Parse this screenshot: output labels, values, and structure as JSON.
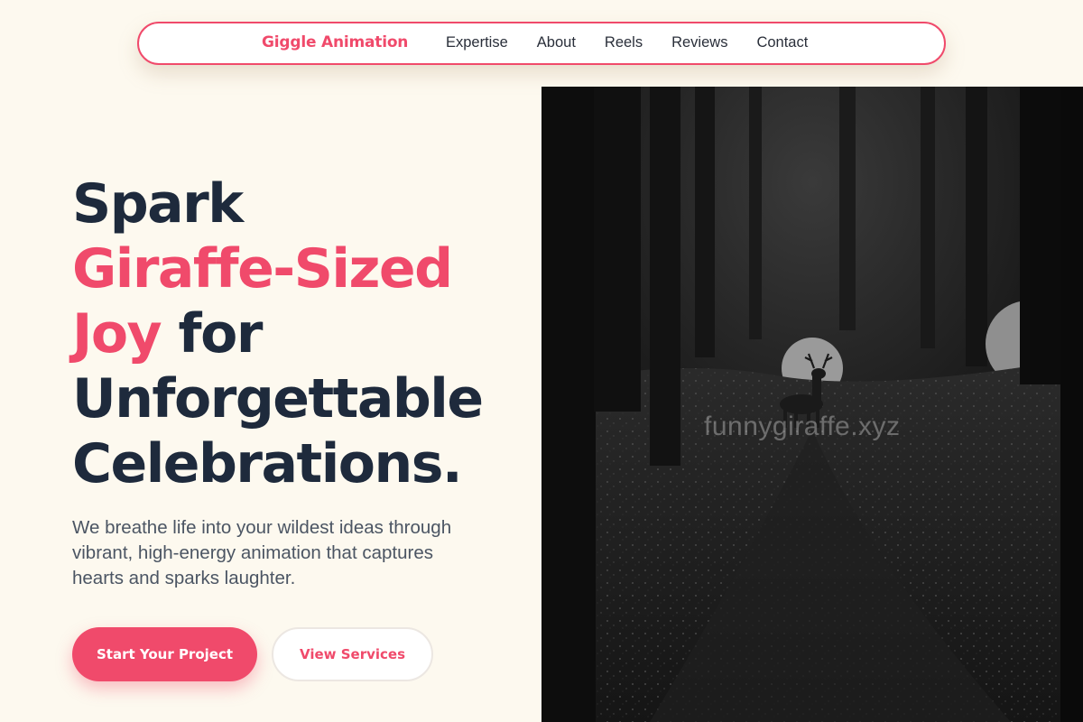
{
  "nav": {
    "brand": "Giggle Animation",
    "links": [
      "Expertise",
      "About",
      "Reels",
      "Reviews",
      "Contact"
    ]
  },
  "hero": {
    "headline": {
      "line1": "Spark",
      "line2": "Giraffe-Sized",
      "line3_accent": "Joy",
      "line3_rest": " for",
      "line4": "Unforgettable",
      "line5": "Celebrations."
    },
    "lead": "We breathe life into your wildest ideas through vibrant, high-energy animation that captures hearts and sparks laughter.",
    "primary_button": "Start Your Project",
    "secondary_button": "View Services"
  },
  "image": {
    "watermark": "funnygiraffe.xyz"
  },
  "colors": {
    "accent": "#f04a6b",
    "heading": "#1e2a3c",
    "background": "#fdf9ef"
  }
}
